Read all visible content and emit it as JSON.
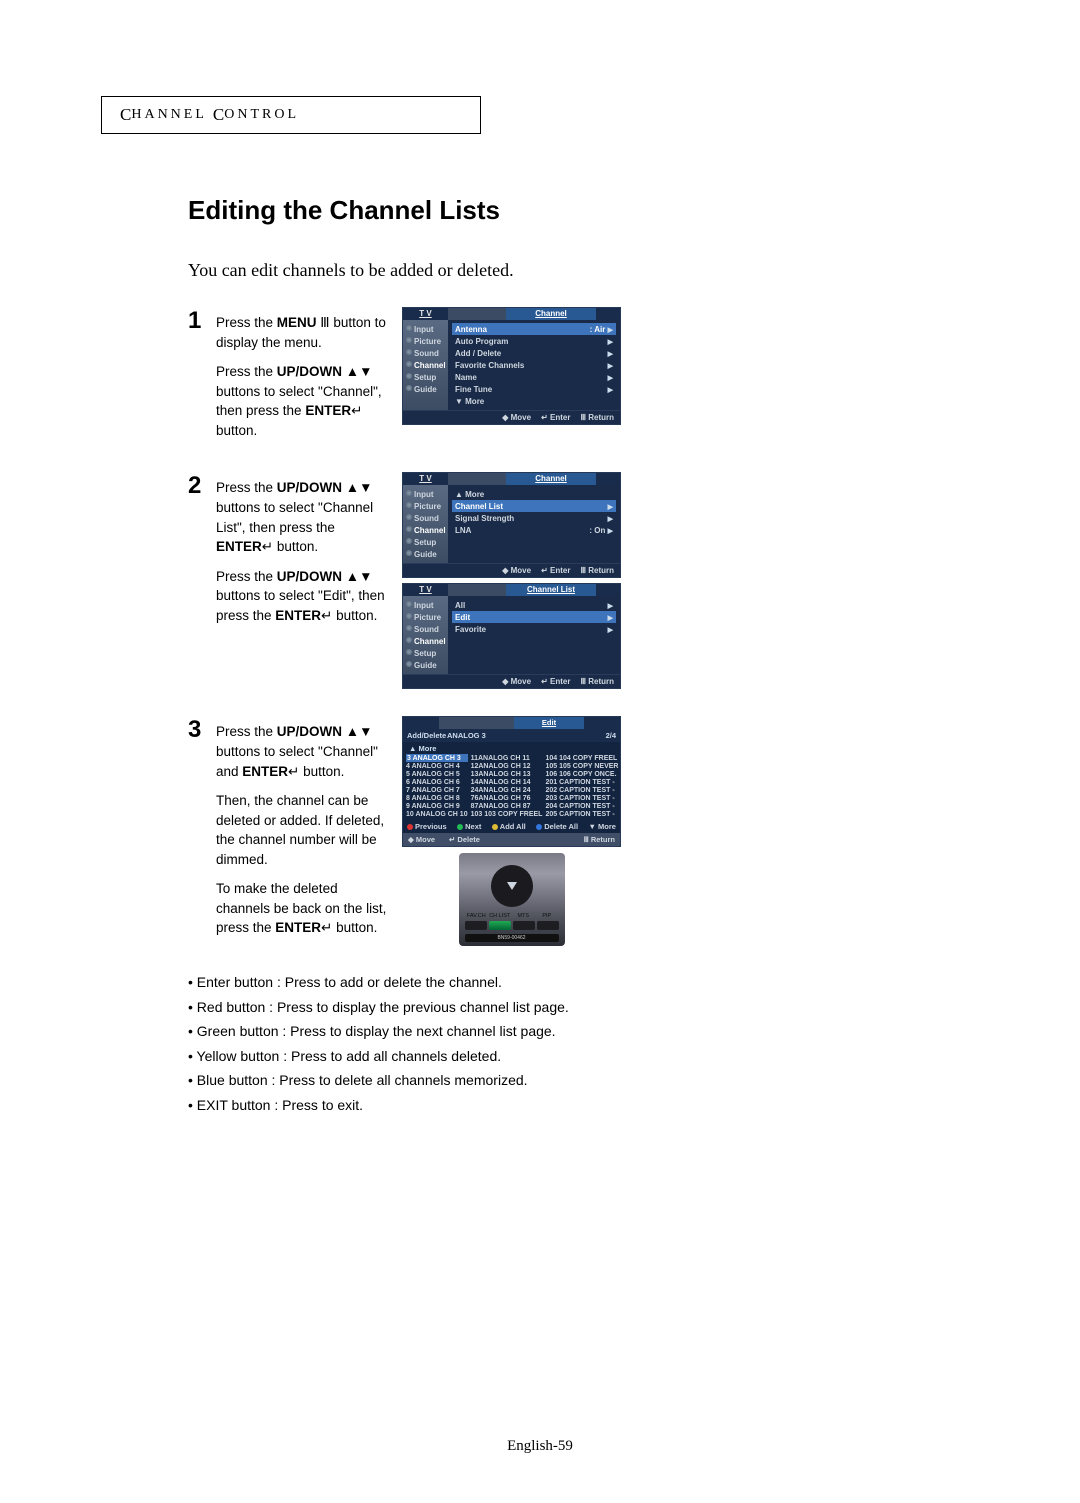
{
  "header": {
    "word1_cap": "C",
    "word1_rest": "HANNEL",
    "word2_cap": "C",
    "word2_rest": "ONTROL"
  },
  "title": "Editing the Channel Lists",
  "intro": "You can edit channels to be added or deleted.",
  "steps": {
    "s1": {
      "num": "1",
      "p1a": "Press the ",
      "p1b": "MENU",
      "p1c": " button to display the menu.",
      "p2a": "Press the ",
      "p2b": "UP/DOWN",
      "p2c": " buttons to select \"Channel\", then press the ",
      "p2d": "ENTER",
      "p2e": " button."
    },
    "s2": {
      "num": "2",
      "p1a": "Press the ",
      "p1b": "UP/DOWN",
      "p1c": " buttons to select \"Channel List\", then press the ",
      "p1d": "ENTER",
      "p1e": " button.",
      "p2a": "Press the ",
      "p2b": "UP/DOWN",
      "p2c": " buttons to select \"Edit\", then press the ",
      "p2d": "ENTER",
      "p2e": " button."
    },
    "s3": {
      "num": "3",
      "p1a": "Press the ",
      "p1b": "UP/DOWN",
      "p1c": " buttons to select \"Channel\" and ",
      "p1d": "ENTER",
      "p1e": " button.",
      "p2": "Then, the channel can be deleted or added. If deleted, the channel number will be dimmed.",
      "p3a": "To make the deleted channels be back on the list, press the ",
      "p3b": "ENTER",
      "p3c": " button."
    }
  },
  "notes": {
    "n1": "• Enter button : Press to add or delete the channel.",
    "n2": "• Red button : Press to display the previous channel list page.",
    "n3": "• Green button : Press to display the next  channel list page.",
    "n4": "• Yellow button : Press to add all channels deleted.",
    "n5": "• Blue button : Press to delete all channels memorized.",
    "n6": "• EXIT button : Press to exit."
  },
  "page_num": "English-59",
  "osd": {
    "tv": "T V",
    "sidebar": [
      "Input",
      "Picture",
      "Sound",
      "Channel",
      "Setup",
      "Guide"
    ],
    "foot": {
      "move": "Move",
      "enter": "Enter",
      "return": "Return"
    },
    "panel1": {
      "title": "Channel",
      "rows": [
        {
          "l": "Antenna",
          "r": ": Air",
          "hl": true
        },
        {
          "l": "Auto Program",
          "r": ""
        },
        {
          "l": "Add / Delete",
          "r": ""
        },
        {
          "l": "Favorite Channels",
          "r": ""
        },
        {
          "l": "Name",
          "r": ""
        },
        {
          "l": "Fine Tune",
          "r": ""
        },
        {
          "l": "▼ More",
          "r": "",
          "noarr": true
        }
      ]
    },
    "panel2": {
      "title": "Channel",
      "rows": [
        {
          "l": "▲ More",
          "r": "",
          "noarr": true
        },
        {
          "l": "Channel List",
          "r": "",
          "hl": true
        },
        {
          "l": "Signal Strength",
          "r": ""
        },
        {
          "l": "LNA",
          "r": ": On"
        }
      ]
    },
    "panel3": {
      "title": "Channel List",
      "rows": [
        {
          "l": "All",
          "r": ""
        },
        {
          "l": "Edit",
          "r": "",
          "hl": true
        },
        {
          "l": "Favorite",
          "r": ""
        }
      ]
    }
  },
  "edit": {
    "title": "Edit",
    "hdr_l": "Add/Delete",
    "hdr_m": "ANALOG 3",
    "hdr_r": "2/4",
    "more_top": "▲ More",
    "more_bot": "▼ More",
    "col1": [
      "3 ANALOG CH 3",
      "4 ANALOG CH 4",
      "5 ANALOG CH 5",
      "6 ANALOG CH 6",
      "7 ANALOG CH 7",
      "8 ANALOG CH 8",
      "9 ANALOG CH 9",
      "10 ANALOG CH 10"
    ],
    "col2": [
      "11ANALOG CH 11",
      "12ANALOG CH 12",
      "13ANALOG CH 13",
      "14ANALOG CH 14",
      "24ANALOG CH 24",
      "76ANALOG CH 76",
      "87ANALOG CH 87",
      "103 103 COPY FREEL"
    ],
    "col3": [
      "104 104 COPY FREEL",
      "105 105 COPY NEVER",
      "106 106 COPY ONCE.",
      "201 CAPTION TEST -",
      "202 CAPTION TEST -",
      "203 CAPTION TEST -",
      "204 CAPTION TEST -",
      "205 CAPTION TEST -"
    ],
    "btns": {
      "prev": "Previous",
      "next": "Next",
      "addall": "Add All",
      "delall": "Delete All"
    },
    "foot": {
      "move": "Move",
      "delete": "Delete",
      "return": "Return"
    }
  },
  "remote": {
    "lab1": "FAV.CH",
    "lab2": "CH LIST",
    "lab3": "MTS",
    "lab4": "PIP",
    "model": "BN59-00462"
  }
}
